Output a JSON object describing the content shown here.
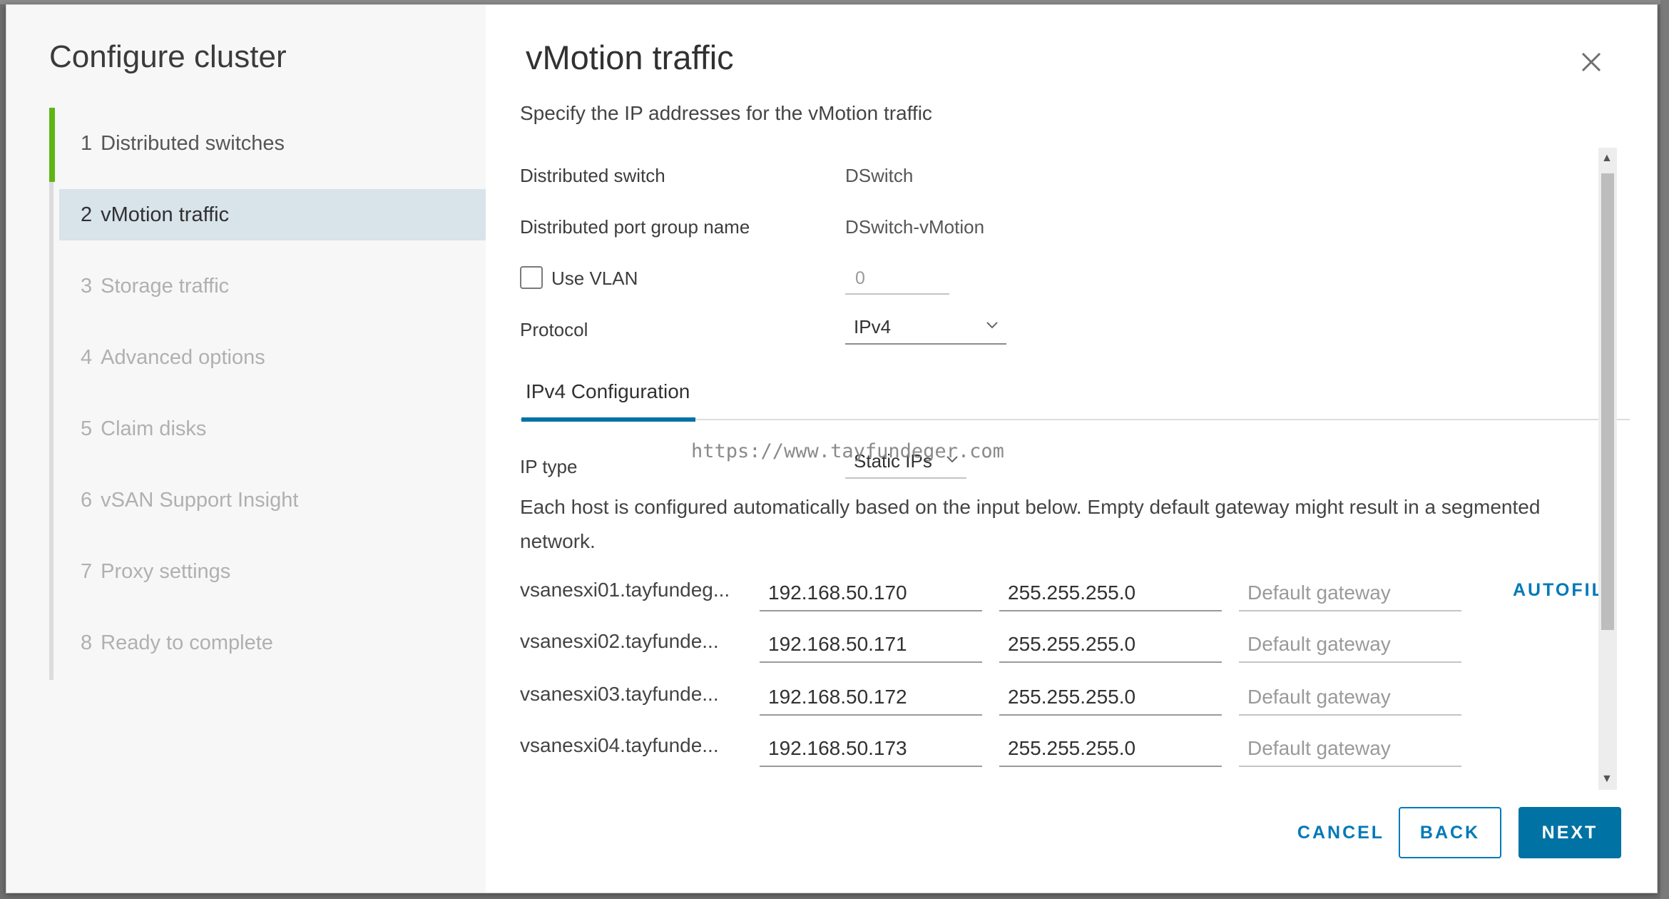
{
  "wizard": {
    "title": "Configure cluster",
    "steps": [
      {
        "num": "1",
        "label": "Distributed switches",
        "state": "done"
      },
      {
        "num": "2",
        "label": "vMotion traffic",
        "state": "active"
      },
      {
        "num": "3",
        "label": "Storage traffic",
        "state": "pending"
      },
      {
        "num": "4",
        "label": "Advanced options",
        "state": "pending"
      },
      {
        "num": "5",
        "label": "Claim disks",
        "state": "pending"
      },
      {
        "num": "6",
        "label": "vSAN Support Insight",
        "state": "pending"
      },
      {
        "num": "7",
        "label": "Proxy settings",
        "state": "pending"
      },
      {
        "num": "8",
        "label": "Ready to complete",
        "state": "pending"
      }
    ]
  },
  "page": {
    "title": "vMotion traffic",
    "subtitle": "Specify the IP addresses for the vMotion traffic",
    "distributed_switch_label": "Distributed switch",
    "distributed_switch_value": "DSwitch",
    "port_group_label": "Distributed port group name",
    "port_group_value": "DSwitch-vMotion",
    "use_vlan_label": "Use VLAN",
    "use_vlan_checked": false,
    "vlan_value": "0",
    "protocol_label": "Protocol",
    "protocol_value": "IPv4",
    "tab_label": "IPv4 Configuration",
    "ip_type_label": "IP type",
    "ip_type_value": "Static IPs",
    "watermark": "https://www.tayfundeger.com",
    "help_text": "Each host is configured automatically based on the input below. Empty default gateway might result in a segmented network.",
    "gateway_placeholder": "Default gateway",
    "autofill_label": "AUTOFILL",
    "hosts": [
      {
        "name": "vsanesxi01.tayfundeg...",
        "ip": "192.168.50.170",
        "mask": "255.255.255.0"
      },
      {
        "name": "vsanesxi02.tayfunde...",
        "ip": "192.168.50.171",
        "mask": "255.255.255.0"
      },
      {
        "name": "vsanesxi03.tayfunde...",
        "ip": "192.168.50.172",
        "mask": "255.255.255.0"
      },
      {
        "name": "vsanesxi04.tayfunde...",
        "ip": "192.168.50.173",
        "mask": "255.255.255.0"
      }
    ]
  },
  "footer": {
    "cancel_label": "CANCEL",
    "back_label": "BACK",
    "next_label": "NEXT"
  },
  "colors": {
    "accent": "#0072a3",
    "link": "#0079b8",
    "complete": "#60b515",
    "active_step_bg": "#d8e3ea"
  }
}
